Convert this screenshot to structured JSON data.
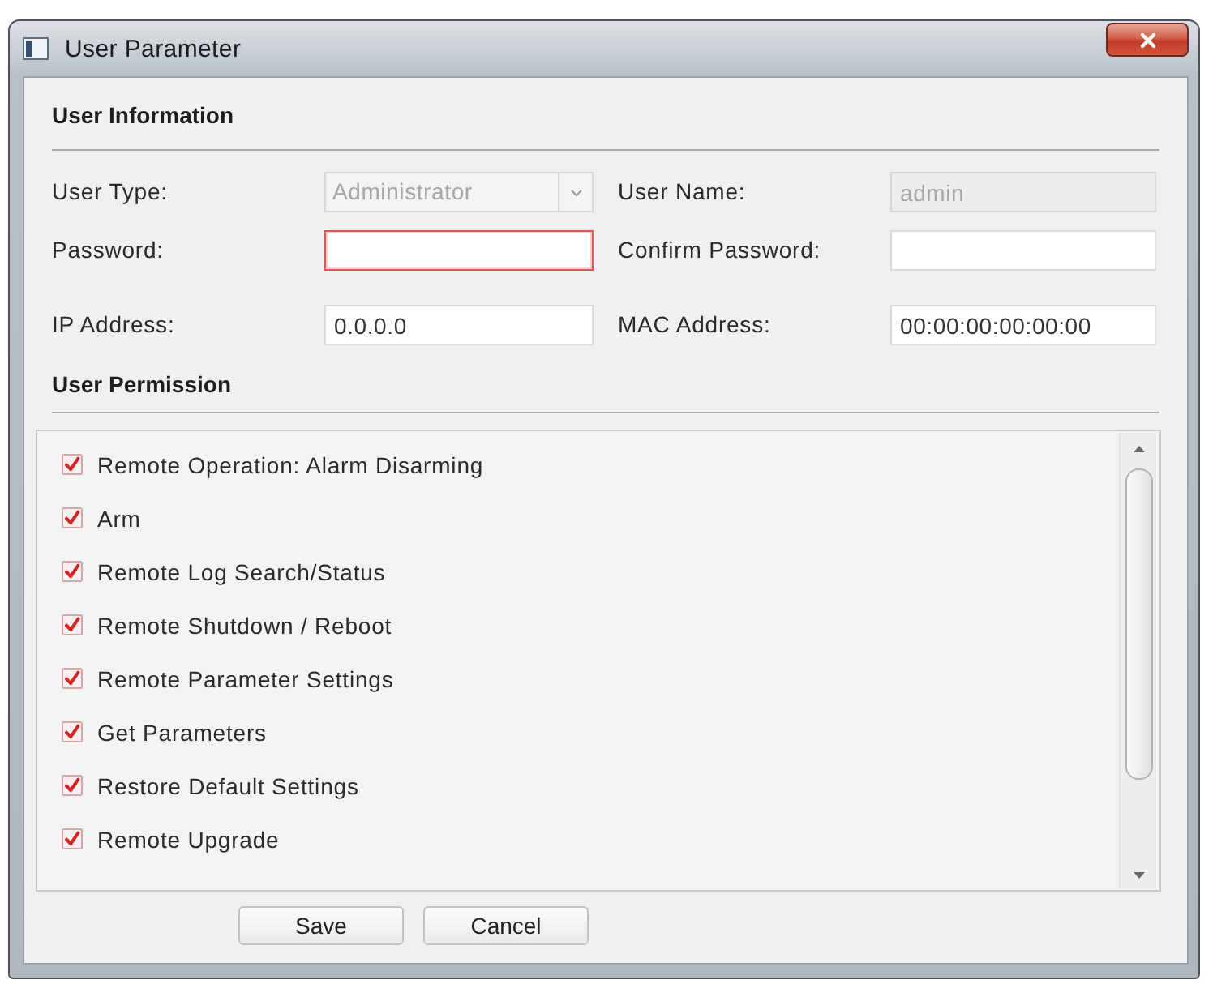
{
  "window": {
    "title": "User Parameter"
  },
  "user_information": {
    "heading": "User Information",
    "fields": [
      {
        "label": "User Type:",
        "kind": "combo",
        "value": "Administrator",
        "disabled": true,
        "error": false
      },
      {
        "label": "User Name:",
        "kind": "text",
        "value": "admin",
        "disabled": true,
        "error": false
      },
      {
        "label": "Password:",
        "kind": "password",
        "disabled": false,
        "error": true
      },
      {
        "label": "Confirm Password:",
        "kind": "password",
        "disabled": false,
        "error": false
      },
      {
        "label": "IP Address:",
        "kind": "text",
        "value": "0.0.0.0",
        "disabled": false,
        "error": false
      },
      {
        "label": "MAC Address:",
        "kind": "text",
        "value": "00:00:00:00:00:00",
        "disabled": false,
        "error": false
      }
    ]
  },
  "user_permission": {
    "heading": "User Permission",
    "items": [
      {
        "label": "Remote Operation: Alarm Disarming",
        "checked": true
      },
      {
        "label": "Arm",
        "checked": true
      },
      {
        "label": "Remote Log Search/Status",
        "checked": true
      },
      {
        "label": "Remote Shutdown / Reboot",
        "checked": true
      },
      {
        "label": "Remote Parameter Settings",
        "checked": true
      },
      {
        "label": "Get Parameters",
        "checked": true
      },
      {
        "label": "Restore Default Settings",
        "checked": true
      },
      {
        "label": "Remote Upgrade",
        "checked": true
      }
    ]
  },
  "buttons": [
    {
      "label": "Save"
    },
    {
      "label": "Cancel"
    }
  ]
}
